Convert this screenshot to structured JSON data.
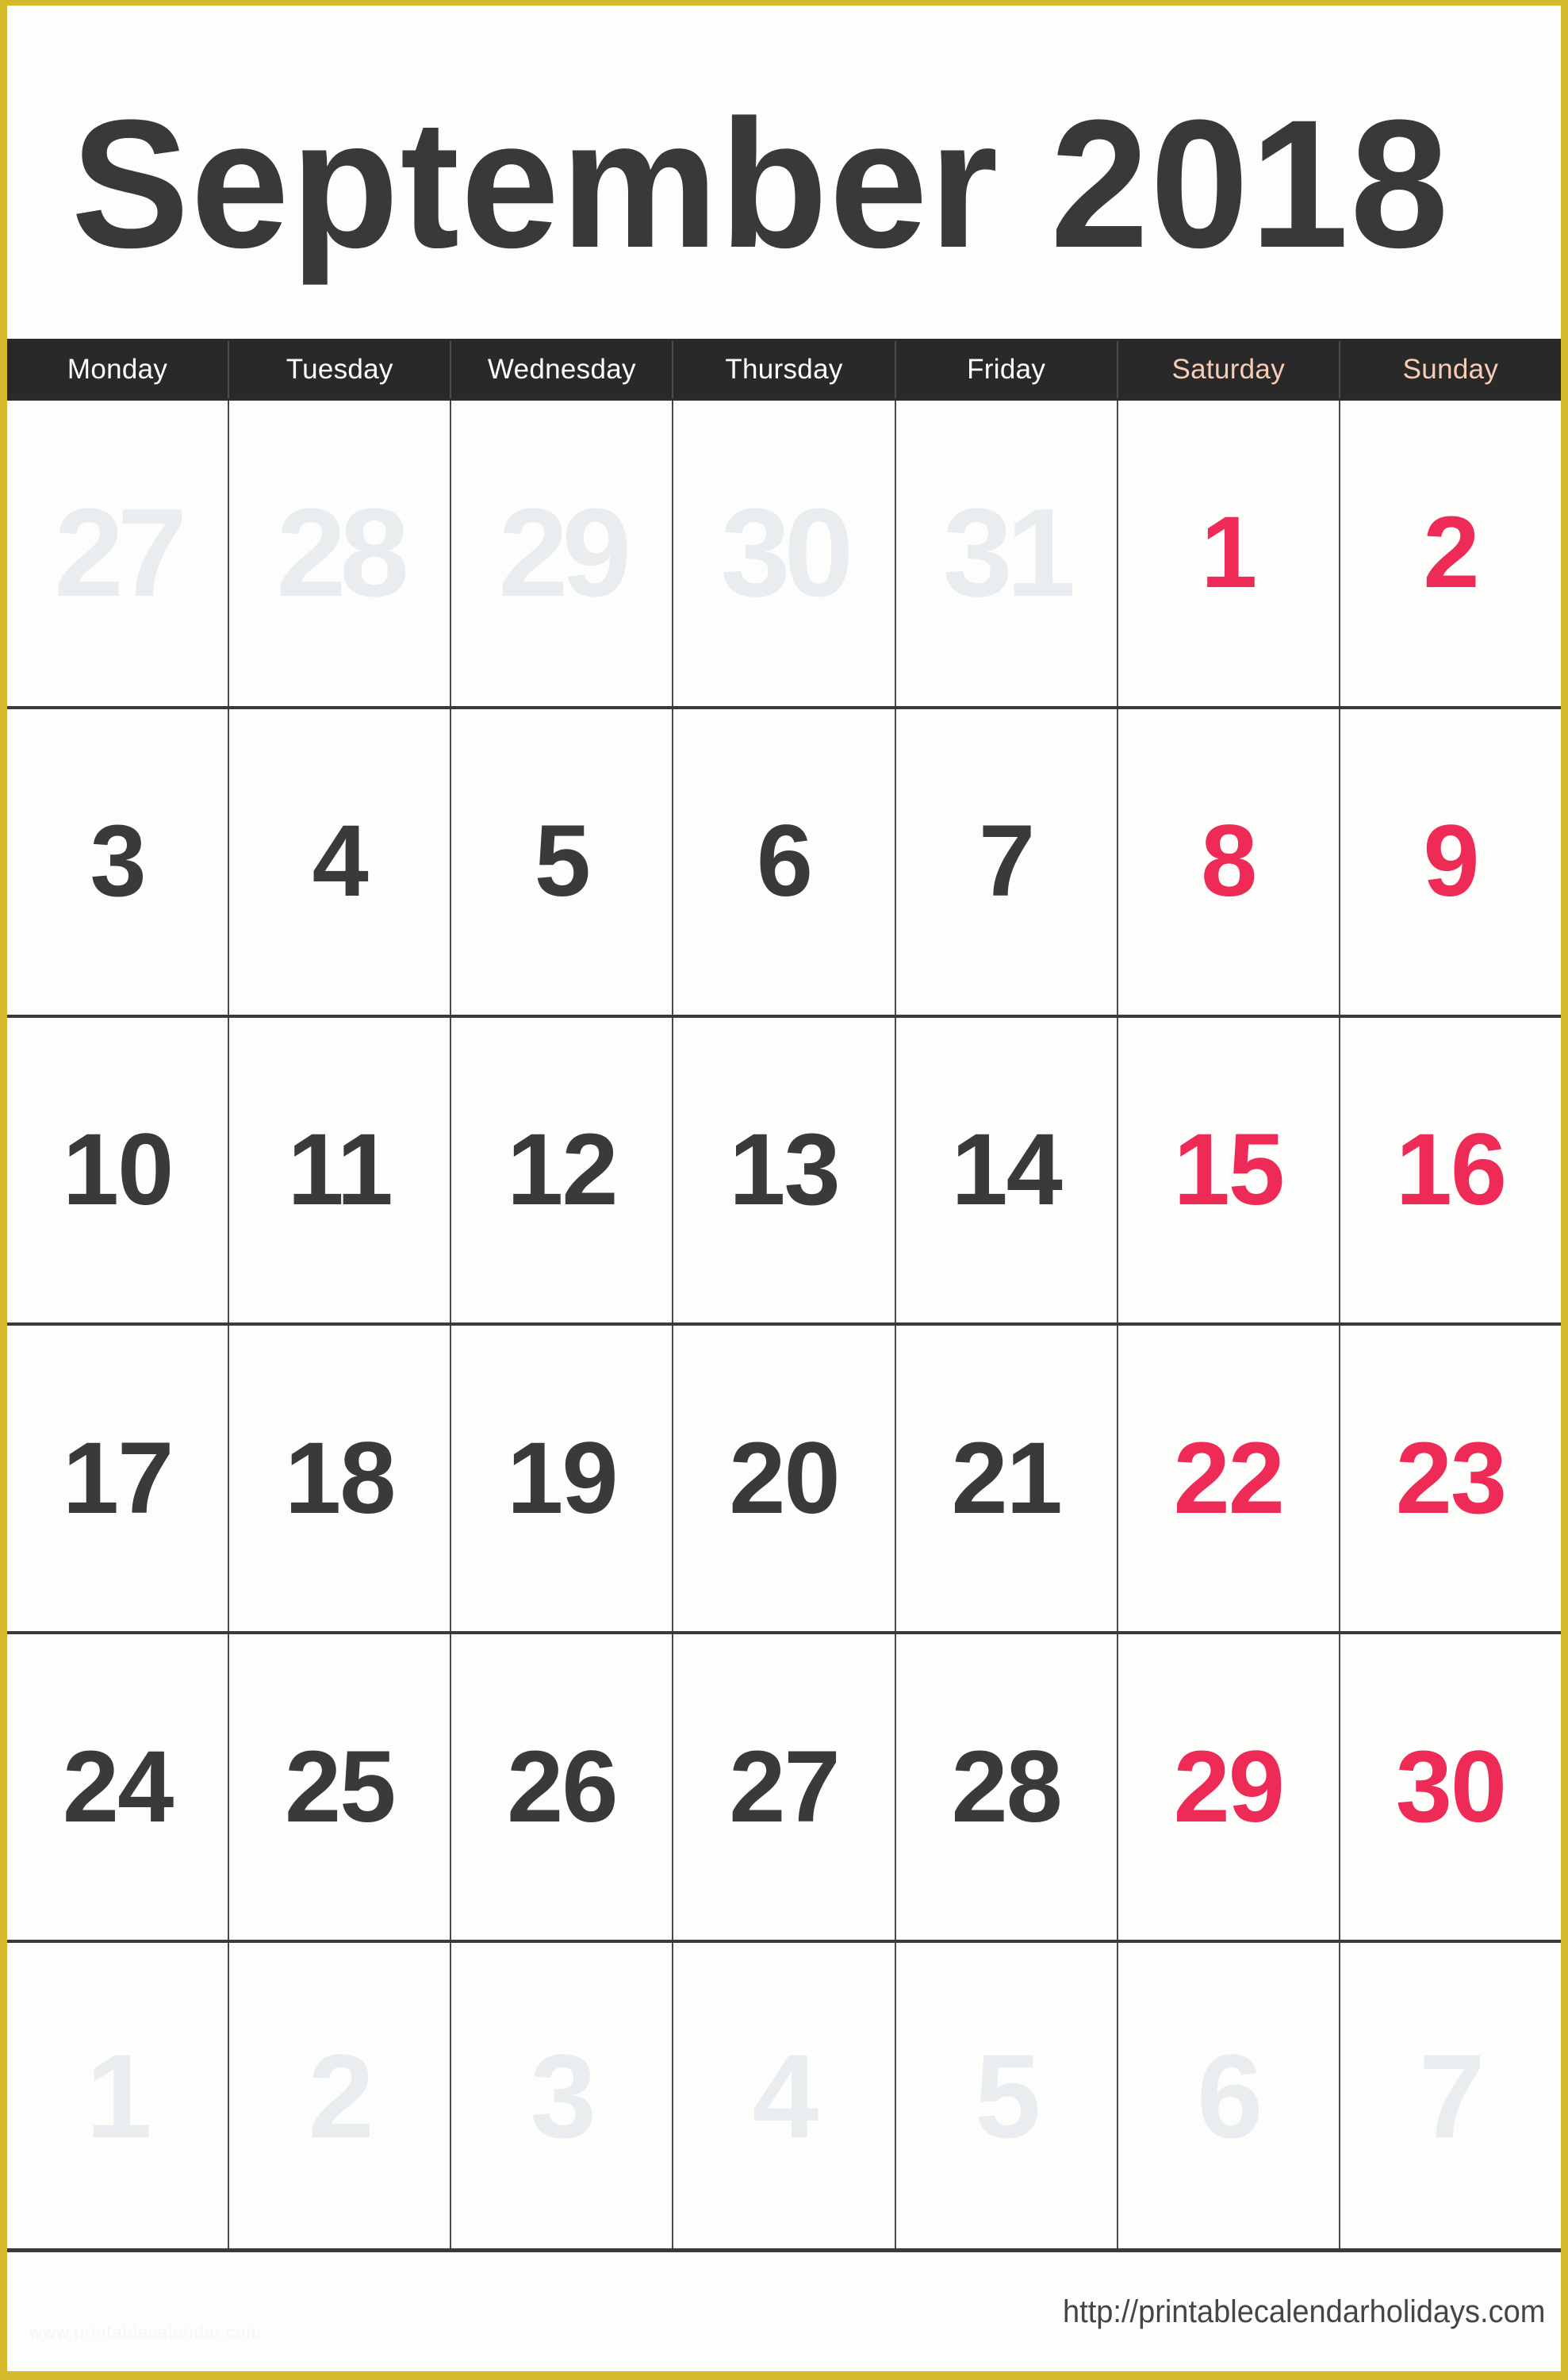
{
  "page": {
    "border_color": "#d6b82b",
    "background": "#fdfdfb"
  },
  "header": {
    "title": "September 2018",
    "title_color": "#393939"
  },
  "weekdays": [
    {
      "label": "Monday",
      "weekend": false
    },
    {
      "label": "Tuesday",
      "weekend": false
    },
    {
      "label": "Wednesday",
      "weekend": false
    },
    {
      "label": "Thursday",
      "weekend": false
    },
    {
      "label": "Friday",
      "weekend": false
    },
    {
      "label": "Saturday",
      "weekend": true
    },
    {
      "label": "Sunday",
      "weekend": true
    }
  ],
  "colors": {
    "weekday_header_text": "#ffffff",
    "weekend_header_text": "#f7cdb6",
    "header_band": "#292929",
    "weekday_number": "#3a3a3a",
    "weekend_number": "#ee2a56",
    "other_month_number": "#e9edf0",
    "grid_line": "#4a4a4a"
  },
  "weeks": [
    {
      "days": [
        {
          "n": "27",
          "month": "prev",
          "weekend": false
        },
        {
          "n": "28",
          "month": "prev",
          "weekend": false
        },
        {
          "n": "29",
          "month": "prev",
          "weekend": false
        },
        {
          "n": "30",
          "month": "prev",
          "weekend": false
        },
        {
          "n": "31",
          "month": "prev",
          "weekend": false
        },
        {
          "n": "1",
          "month": "current",
          "weekend": true
        },
        {
          "n": "2",
          "month": "current",
          "weekend": true
        }
      ]
    },
    {
      "days": [
        {
          "n": "3",
          "month": "current",
          "weekend": false
        },
        {
          "n": "4",
          "month": "current",
          "weekend": false
        },
        {
          "n": "5",
          "month": "current",
          "weekend": false
        },
        {
          "n": "6",
          "month": "current",
          "weekend": false
        },
        {
          "n": "7",
          "month": "current",
          "weekend": false
        },
        {
          "n": "8",
          "month": "current",
          "weekend": true
        },
        {
          "n": "9",
          "month": "current",
          "weekend": true
        }
      ]
    },
    {
      "days": [
        {
          "n": "10",
          "month": "current",
          "weekend": false
        },
        {
          "n": "11",
          "month": "current",
          "weekend": false
        },
        {
          "n": "12",
          "month": "current",
          "weekend": false
        },
        {
          "n": "13",
          "month": "current",
          "weekend": false
        },
        {
          "n": "14",
          "month": "current",
          "weekend": false
        },
        {
          "n": "15",
          "month": "current",
          "weekend": true
        },
        {
          "n": "16",
          "month": "current",
          "weekend": true
        }
      ]
    },
    {
      "days": [
        {
          "n": "17",
          "month": "current",
          "weekend": false
        },
        {
          "n": "18",
          "month": "current",
          "weekend": false
        },
        {
          "n": "19",
          "month": "current",
          "weekend": false
        },
        {
          "n": "20",
          "month": "current",
          "weekend": false
        },
        {
          "n": "21",
          "month": "current",
          "weekend": false
        },
        {
          "n": "22",
          "month": "current",
          "weekend": true
        },
        {
          "n": "23",
          "month": "current",
          "weekend": true
        }
      ]
    },
    {
      "days": [
        {
          "n": "24",
          "month": "current",
          "weekend": false
        },
        {
          "n": "25",
          "month": "current",
          "weekend": false
        },
        {
          "n": "26",
          "month": "current",
          "weekend": false
        },
        {
          "n": "27",
          "month": "current",
          "weekend": false
        },
        {
          "n": "28",
          "month": "current",
          "weekend": false
        },
        {
          "n": "29",
          "month": "current",
          "weekend": true
        },
        {
          "n": "30",
          "month": "current",
          "weekend": true
        }
      ]
    },
    {
      "days": [
        {
          "n": "1",
          "month": "next",
          "weekend": false
        },
        {
          "n": "2",
          "month": "next",
          "weekend": false
        },
        {
          "n": "3",
          "month": "next",
          "weekend": false
        },
        {
          "n": "4",
          "month": "next",
          "weekend": false
        },
        {
          "n": "5",
          "month": "next",
          "weekend": false
        },
        {
          "n": "6",
          "month": "next",
          "weekend": true
        },
        {
          "n": "7",
          "month": "next",
          "weekend": true
        }
      ]
    }
  ],
  "footer": {
    "url": "http://printablecalendarholidays.com",
    "watermark": "www.printablecalendar.com"
  }
}
